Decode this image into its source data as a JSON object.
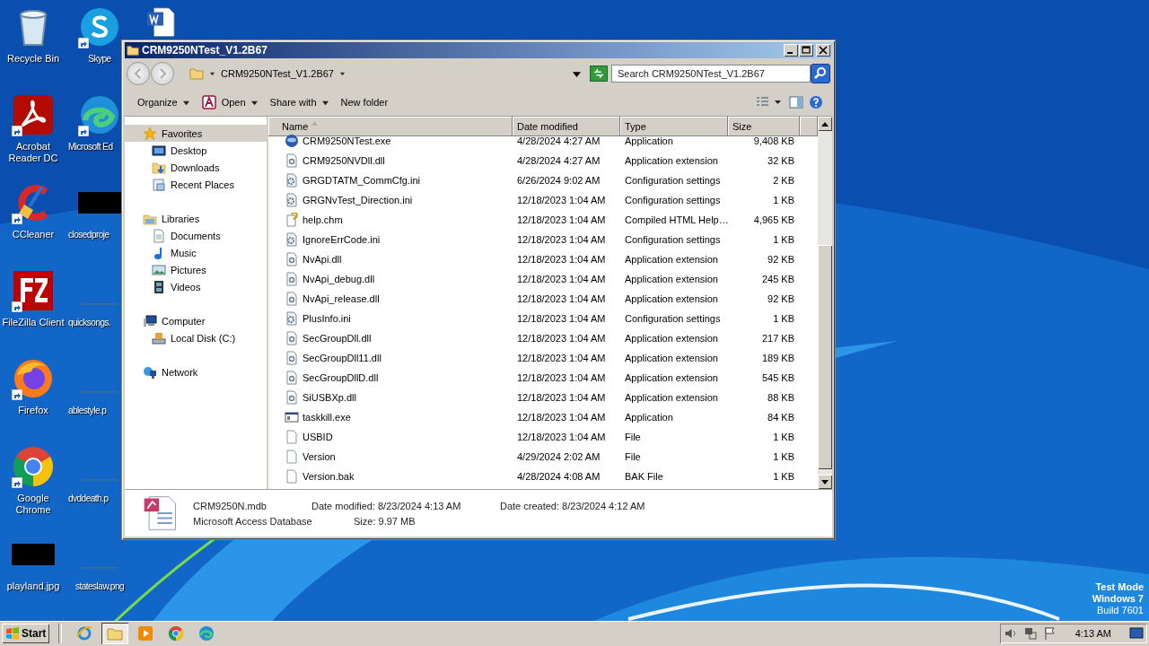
{
  "desktop_columns": [
    [
      {
        "label": "Recycle Bin",
        "kind": "recycle"
      },
      {
        "label": "Acrobat Reader DC",
        "kind": "acrobat",
        "shortcut": true
      },
      {
        "label": "CCleaner",
        "kind": "ccleaner",
        "shortcut": true
      },
      {
        "label": "FileZilla Client",
        "kind": "filezilla",
        "shortcut": true
      },
      {
        "label": "Firefox",
        "kind": "firefox",
        "shortcut": true
      },
      {
        "label": "Google Chrome",
        "kind": "chrome",
        "shortcut": true
      },
      {
        "label": "playland.jpg",
        "kind": "black"
      }
    ],
    [
      {
        "label": "Skype",
        "kind": "skype",
        "shortcut": true
      },
      {
        "label": "Microsoft Ed",
        "kind": "edge",
        "shortcut": true
      },
      {
        "label": "closedproje",
        "kind": "black"
      },
      {
        "label": "quicksongs.",
        "kind": "blank"
      },
      {
        "label": "ablestyle.p",
        "kind": "blank"
      },
      {
        "label": "dvddeath.p",
        "kind": "blank"
      },
      {
        "label": "stateslaw.png",
        "kind": "blank"
      }
    ],
    [
      {
        "kind": "word"
      }
    ]
  ],
  "window": {
    "title": "CRM9250NTest_V1.2B67",
    "address": "CRM9250NTest_V1.2B67",
    "search": {
      "placeholder": "Search CRM9250NTest_V1.2B67"
    },
    "toolbar": [
      "Organize",
      "Open",
      "Share with",
      "New folder"
    ],
    "nav": [
      {
        "label": "Favorites",
        "kind": "star",
        "selected": true,
        "children": [
          {
            "label": "Desktop",
            "kind": "desktop",
            "selected": false
          },
          {
            "label": "Downloads",
            "kind": "downloads",
            "selected": false
          },
          {
            "label": "Recent Places",
            "kind": "recent",
            "selected": false
          }
        ]
      },
      {
        "label": "Libraries",
        "kind": "libraries",
        "selected": false,
        "children": [
          {
            "label": "Documents",
            "kind": "documents",
            "selected": false
          },
          {
            "label": "Music",
            "kind": "music",
            "selected": false
          },
          {
            "label": "Pictures",
            "kind": "pictures",
            "selected": false
          },
          {
            "label": "Videos",
            "kind": "videos",
            "selected": false
          }
        ]
      },
      {
        "label": "Computer",
        "kind": "computer",
        "selected": false,
        "children": [
          {
            "label": "Local Disk (C:)",
            "kind": "disk",
            "selected": false
          }
        ]
      },
      {
        "label": "Network",
        "kind": "network",
        "selected": false
      }
    ],
    "columns": [
      "Name",
      "Date modified",
      "Type",
      "Size"
    ],
    "files": [
      {
        "name": "CRM9250NTest.exe",
        "date": "4/28/2024 4:27 AM",
        "type": "Application",
        "size": "9,408 KB",
        "kind": "app-logo"
      },
      {
        "name": "CRM9250NVDll.dll",
        "date": "4/28/2024 4:27 AM",
        "type": "Application extension",
        "size": "32 KB",
        "kind": "dll"
      },
      {
        "name": "GRGDTATM_CommCfg.ini",
        "date": "6/26/2024 9:02 AM",
        "type": "Configuration settings",
        "size": "2 KB",
        "kind": "ini"
      },
      {
        "name": "GRGNvTest_Direction.ini",
        "date": "12/18/2023 1:04 AM",
        "type": "Configuration settings",
        "size": "1 KB",
        "kind": "ini"
      },
      {
        "name": "help.chm",
        "date": "12/18/2023 1:04 AM",
        "type": "Compiled HTML Help…",
        "size": "4,965 KB",
        "kind": "chm"
      },
      {
        "name": "IgnoreErrCode.ini",
        "date": "12/18/2023 1:04 AM",
        "type": "Configuration settings",
        "size": "1 KB",
        "kind": "ini"
      },
      {
        "name": "NvApi.dll",
        "date": "12/18/2023 1:04 AM",
        "type": "Application extension",
        "size": "92 KB",
        "kind": "dll"
      },
      {
        "name": "NvApi_debug.dll",
        "date": "12/18/2023 1:04 AM",
        "type": "Application extension",
        "size": "245 KB",
        "kind": "dll"
      },
      {
        "name": "NvApi_release.dll",
        "date": "12/18/2023 1:04 AM",
        "type": "Application extension",
        "size": "92 KB",
        "kind": "dll"
      },
      {
        "name": "PlusInfo.ini",
        "date": "12/18/2023 1:04 AM",
        "type": "Configuration settings",
        "size": "1 KB",
        "kind": "ini"
      },
      {
        "name": "SecGroupDll.dll",
        "date": "12/18/2023 1:04 AM",
        "type": "Application extension",
        "size": "217 KB",
        "kind": "dll"
      },
      {
        "name": "SecGroupDll11.dll",
        "date": "12/18/2023 1:04 AM",
        "type": "Application extension",
        "size": "189 KB",
        "kind": "dll"
      },
      {
        "name": "SecGroupDllD.dll",
        "date": "12/18/2023 1:04 AM",
        "type": "Application extension",
        "size": "545 KB",
        "kind": "dll"
      },
      {
        "name": "SiUSBXp.dll",
        "date": "12/18/2023 1:04 AM",
        "type": "Application extension",
        "size": "88 KB",
        "kind": "dll"
      },
      {
        "name": "taskkill.exe",
        "date": "12/18/2023 1:04 AM",
        "type": "Application",
        "size": "84 KB",
        "kind": "exe"
      },
      {
        "name": "USBID",
        "date": "12/18/2023 1:04 AM",
        "type": "File",
        "size": "1 KB",
        "kind": "file"
      },
      {
        "name": "Version",
        "date": "4/29/2024 2:02 AM",
        "type": "File",
        "size": "1 KB",
        "kind": "file"
      },
      {
        "name": "Version.bak",
        "date": "4/28/2024 4:08 AM",
        "type": "BAK File",
        "size": "1 KB",
        "kind": "file"
      }
    ],
    "details": {
      "name": "CRM9250N.mdb",
      "type": "Microsoft Access Database",
      "modified": "Date modified: 8/23/2024 4:13 AM",
      "size": "Size: 9.97 MB",
      "created": "Date created: 8/23/2024 4:12 AM"
    }
  },
  "watermark": [
    "Test Mode",
    "Windows 7",
    "Build 7601"
  ],
  "taskbar": {
    "start": "Start",
    "apps": [
      {
        "kind": "ie",
        "selected": false
      },
      {
        "kind": "explorer",
        "selected": true
      },
      {
        "kind": "media",
        "selected": false
      },
      {
        "kind": "chrome",
        "selected": false
      },
      {
        "kind": "edge",
        "selected": false
      }
    ],
    "clock": "4:13 AM"
  }
}
